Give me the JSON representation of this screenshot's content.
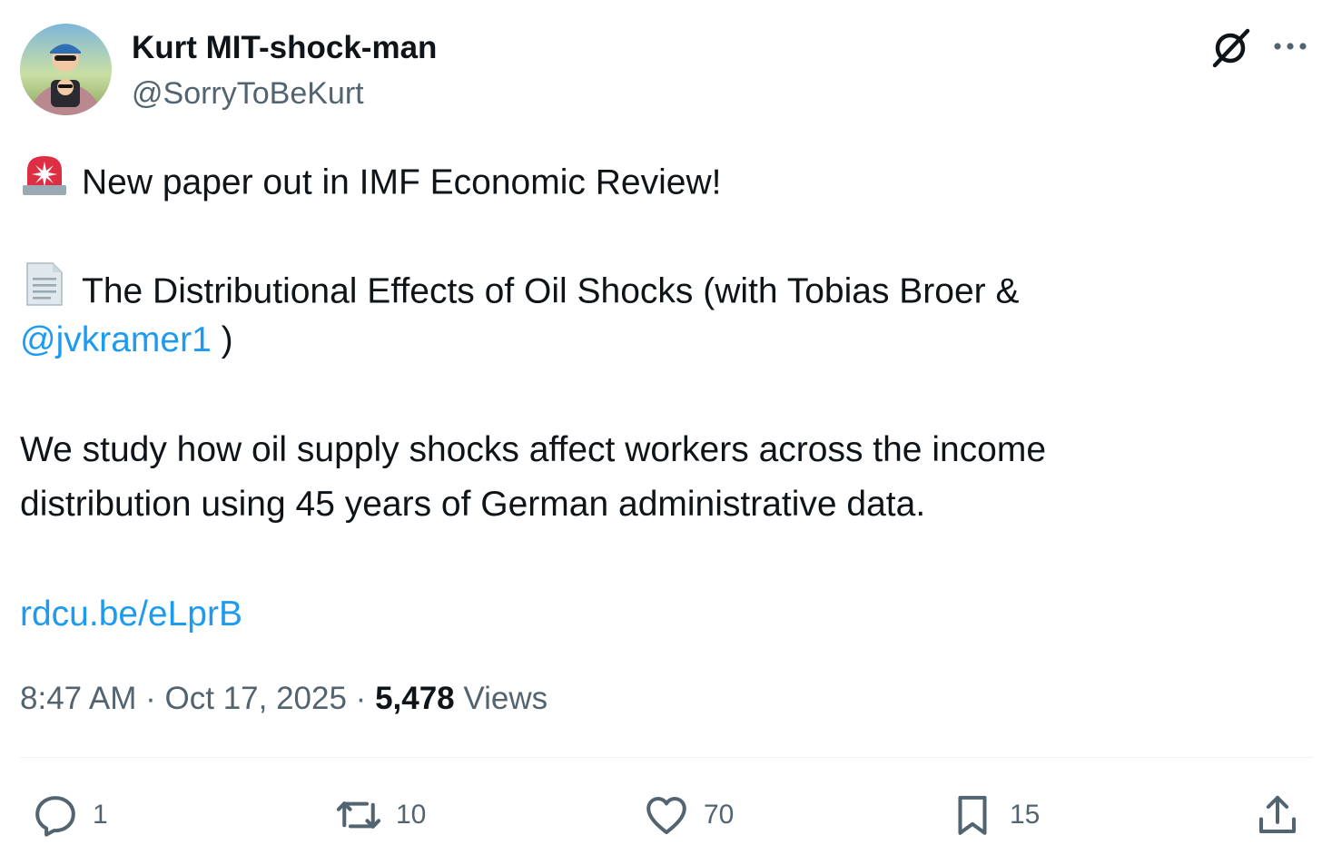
{
  "author": {
    "display_name": "Kurt MIT-shock-man",
    "handle": "@SorryToBeKurt"
  },
  "tweet": {
    "line1": "New paper out in IMF Economic Review!",
    "line2": "The Distributional Effects of Oil Shocks (with Tobias Broer &",
    "mention": "@jvkramer1",
    "mention_suffix": " )",
    "line3a": "We study how oil supply shocks affect workers across the income",
    "line3b": "distribution using 45 years of German administrative data.",
    "link": "rdcu.be/eLprB"
  },
  "meta": {
    "time": "8:47 AM",
    "separator1": " · ",
    "date": "Oct 17, 2025",
    "separator2": " · ",
    "views_count": "5,478",
    "views_label": " Views"
  },
  "actions": {
    "replies": "1",
    "reposts": "10",
    "likes": "70",
    "bookmarks": "15"
  },
  "icons": {
    "header": [
      "grok-icon",
      "more-icon"
    ],
    "emoji": [
      "police-light-icon",
      "page-icon"
    ],
    "actions": [
      "reply-icon",
      "repost-icon",
      "like-icon",
      "bookmark-icon",
      "share-icon"
    ]
  },
  "colors": {
    "text": "#0f1419",
    "secondary": "#536471",
    "link": "#1d9bf0",
    "divider": "#eff3f4"
  }
}
